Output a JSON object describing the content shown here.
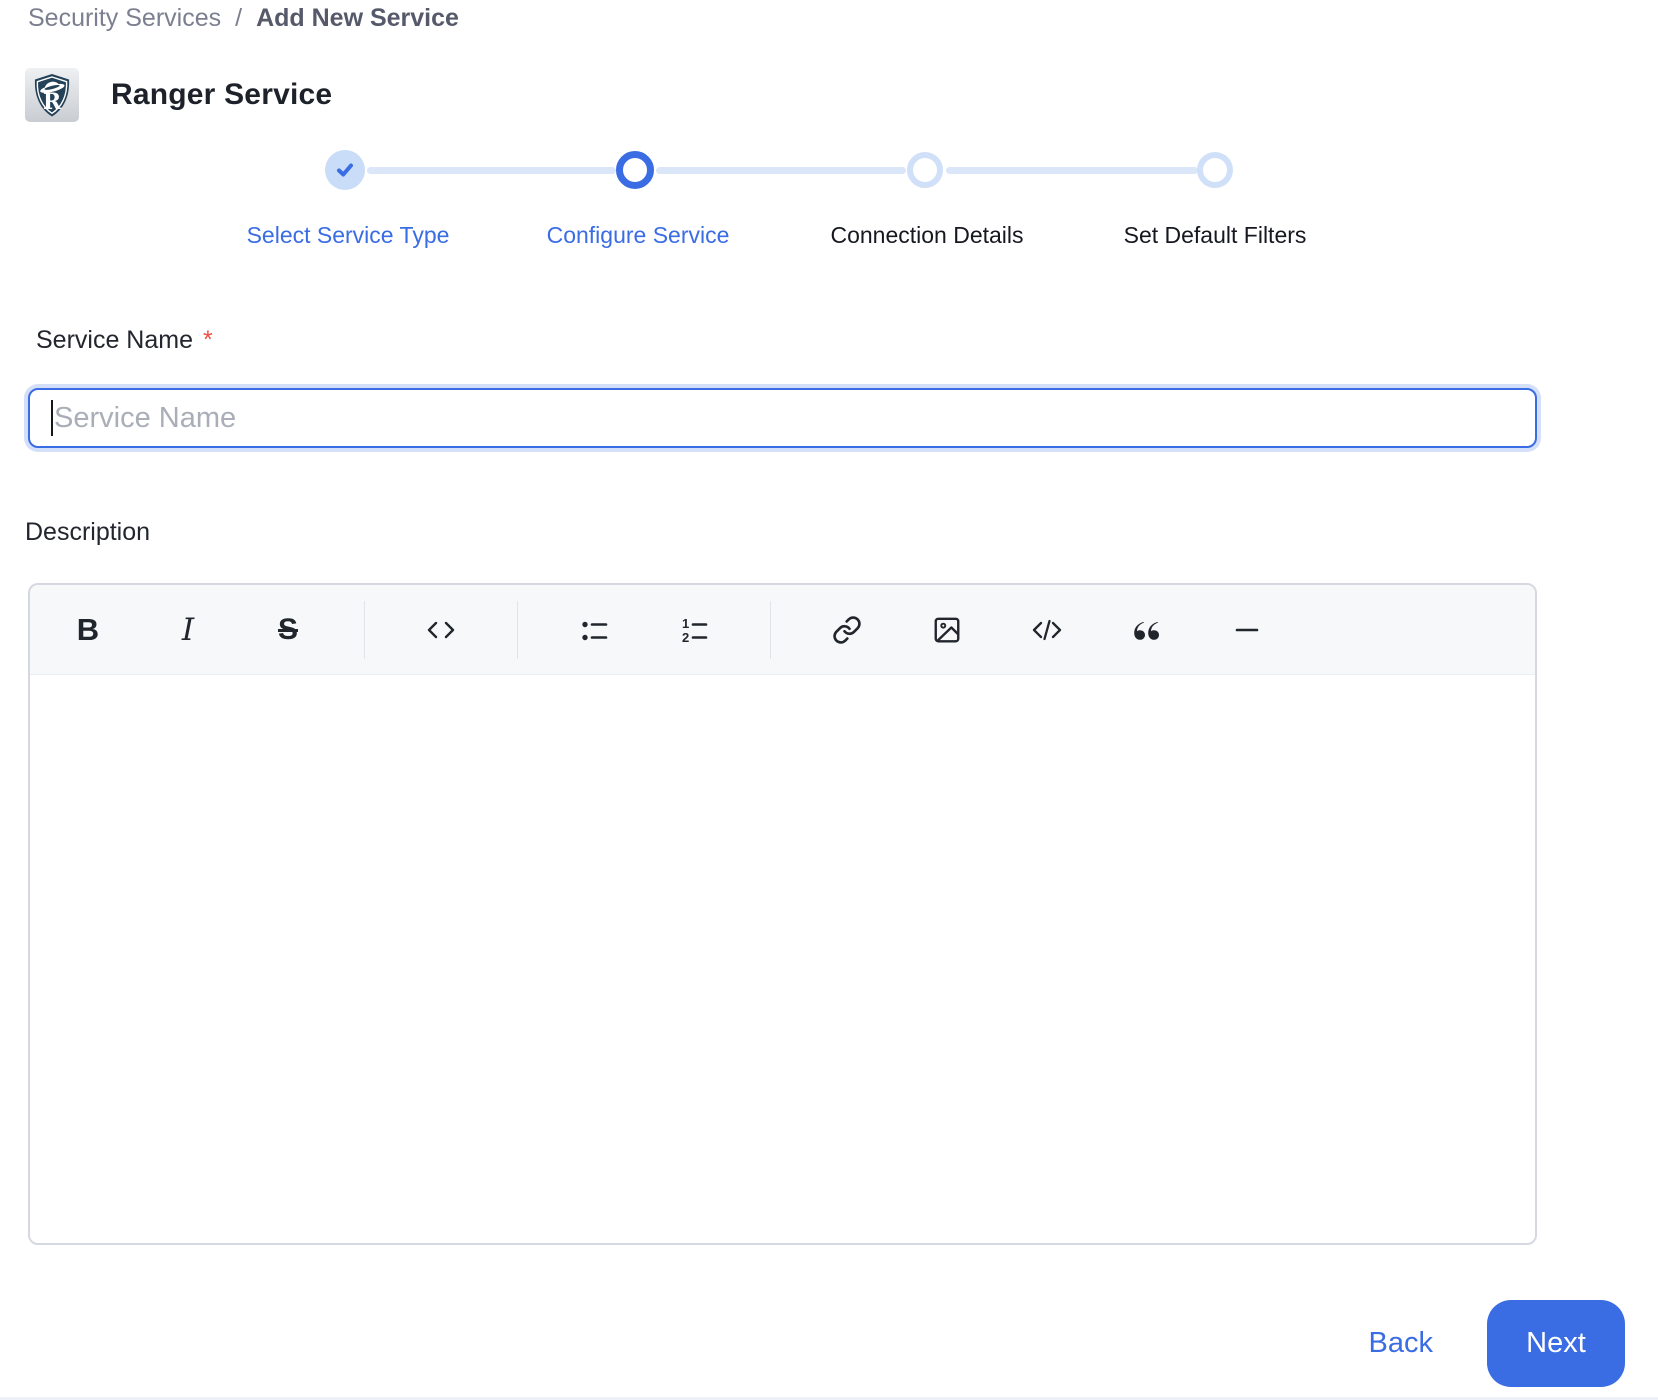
{
  "breadcrumb": {
    "parent": "Security Services",
    "separator": "/",
    "current": "Add New Service"
  },
  "header": {
    "title": "Ranger Service",
    "logo_icon": "ranger-shield-logo"
  },
  "stepper": {
    "steps": [
      {
        "label": "Select Service Type",
        "state": "completed"
      },
      {
        "label": "Configure Service",
        "state": "active"
      },
      {
        "label": "Connection Details",
        "state": "pending"
      },
      {
        "label": "Set Default Filters",
        "state": "pending"
      }
    ]
  },
  "form": {
    "service_name": {
      "label": "Service Name",
      "required_marker": "*",
      "placeholder": "Service Name",
      "value": ""
    },
    "description": {
      "label": "Description",
      "value": "",
      "toolbar_groups": [
        {
          "buttons": [
            "bold",
            "italic",
            "strikethrough"
          ]
        },
        {
          "buttons": [
            "inline-code"
          ]
        },
        {
          "buttons": [
            "bullet-list",
            "ordered-list"
          ]
        },
        {
          "buttons": [
            "link",
            "image",
            "code-block",
            "blockquote",
            "horizontal-rule"
          ]
        }
      ]
    }
  },
  "footer": {
    "back_label": "Back",
    "next_label": "Next"
  },
  "colors": {
    "accent_blue": "#3a6ce4",
    "completed_circle_fill": "#c9dcf8",
    "pending_ring": "#cfe0f8",
    "connector": "#dbe6f9",
    "required_red": "#ee4f43",
    "toolbar_bg": "#f6f8fa",
    "breadcrumb_gray": "#7c7f90"
  }
}
